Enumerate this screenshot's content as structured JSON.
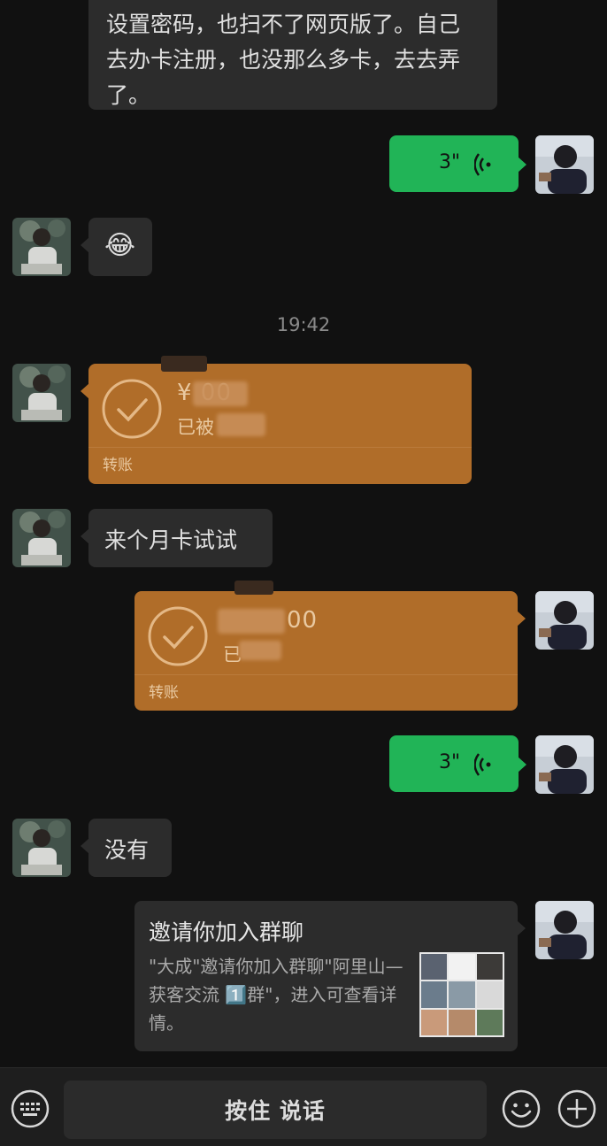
{
  "messages": {
    "top_text": "设置密码，也扫不了网页版了。自己去办卡注册，也没那么多卡，去去弄了。",
    "voice1": {
      "duration": "3\""
    },
    "emoji1": "😂",
    "timestamp": "19:42",
    "transfer1": {
      "amount": "¥  00",
      "status": "已被",
      "type": "转账"
    },
    "text2": "来个月卡试试",
    "transfer2": {
      "amount": "00",
      "status": "已",
      "type": "转账"
    },
    "voice2": {
      "duration": "3\""
    },
    "text3": "没有",
    "invite": {
      "title": "邀请你加入群聊",
      "body": "\"大成\"邀请你加入群聊\"阿里山—获客交流 1️⃣群\"，进入可查看详情。"
    }
  },
  "bottom_bar": {
    "hold_to_talk": "按住 说话",
    "keyboard_icon": "keyboard-icon",
    "emoji_icon": "emoji-icon",
    "plus_icon": "plus-icon"
  },
  "colors": {
    "background": "#111111",
    "bubble_dark": "#2c2c2c",
    "bubble_green": "#21b457",
    "transfer": "#b06d29"
  }
}
